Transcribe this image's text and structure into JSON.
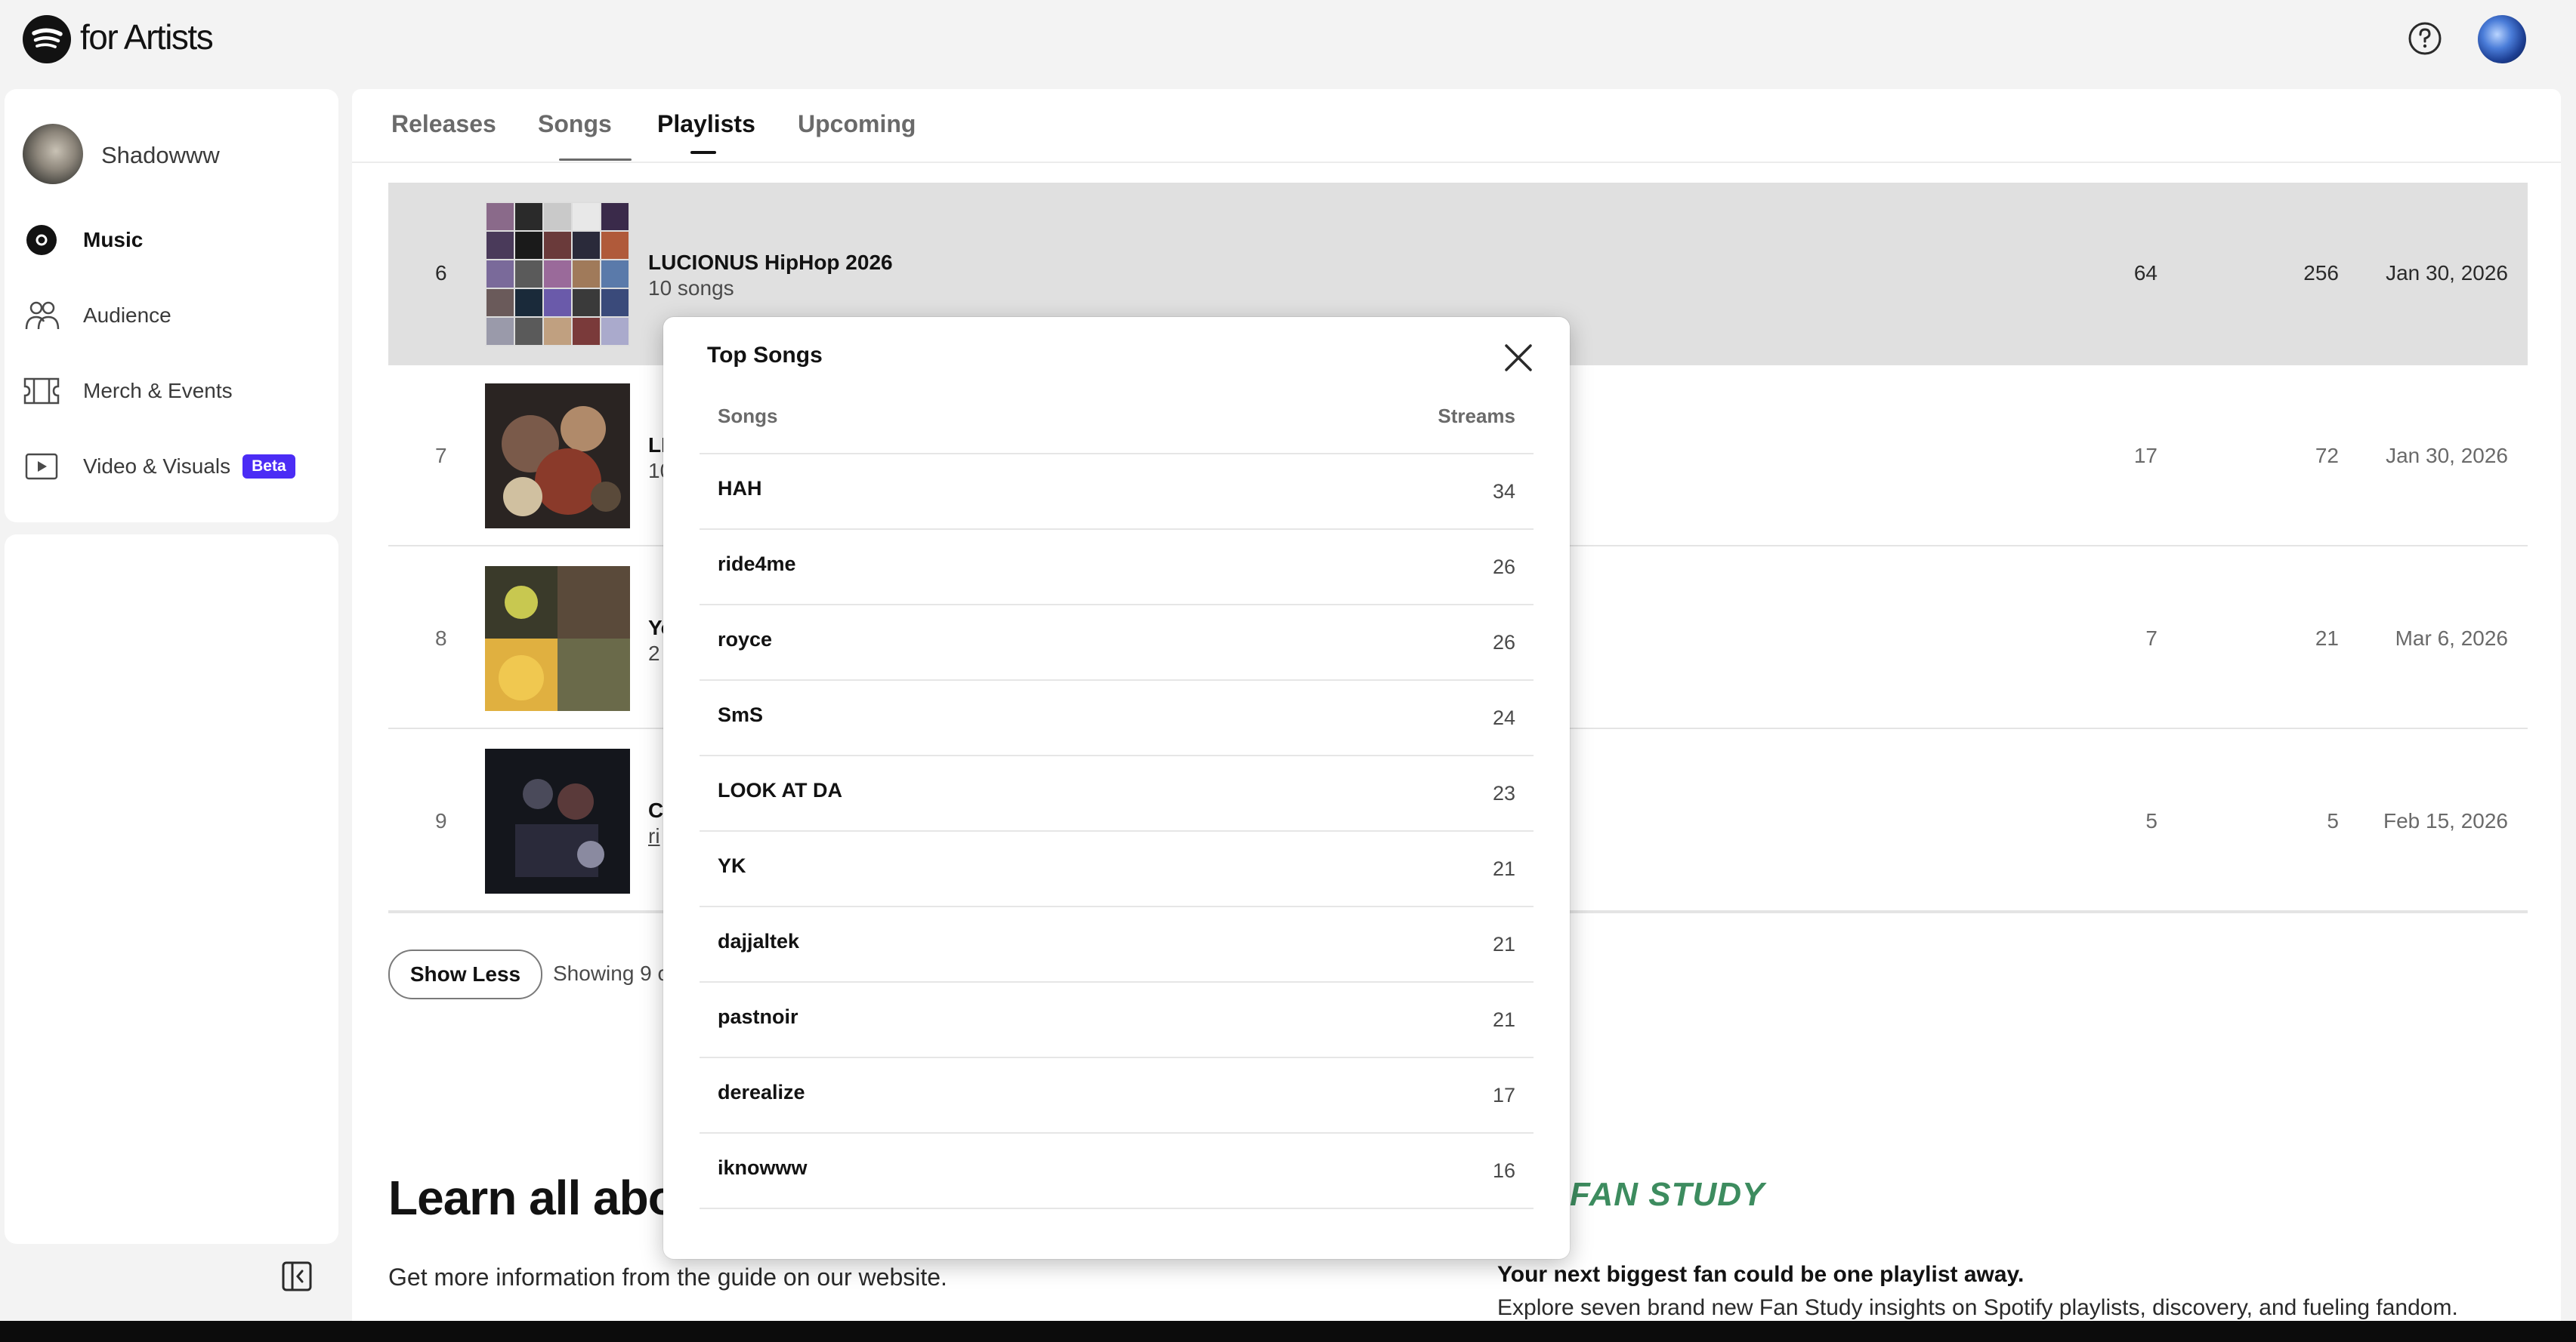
{
  "app": {
    "brand": "for Artists"
  },
  "sidebar": {
    "artist_name": "Shadowww",
    "items": [
      {
        "label": "Music",
        "icon": "music-disc-icon",
        "active": true
      },
      {
        "label": "Audience",
        "icon": "audience-icon"
      },
      {
        "label": "Merch & Events",
        "icon": "ticket-icon"
      },
      {
        "label": "Video & Visuals",
        "icon": "video-icon",
        "badge": "Beta"
      }
    ]
  },
  "tabs": [
    {
      "label": "Releases"
    },
    {
      "label": "Songs"
    },
    {
      "label": "Playlists",
      "active": true
    },
    {
      "label": "Upcoming"
    }
  ],
  "playlists": [
    {
      "rank": "6",
      "title": "LUCIONUS HipHop 2026",
      "subtitle": "10 songs",
      "listeners": "64",
      "streams": "256",
      "date": "Jan 30, 2026"
    },
    {
      "rank": "7",
      "title": "LI",
      "subtitle": "10",
      "listeners": "17",
      "streams": "72",
      "date": "Jan 30, 2026"
    },
    {
      "rank": "8",
      "title": "Yo",
      "subtitle": "2",
      "listeners": "7",
      "streams": "21",
      "date": "Mar 6, 2026"
    },
    {
      "rank": "9",
      "title": "Cl",
      "subtitle": "ri",
      "listeners": "5",
      "streams": "5",
      "date": "Feb 15, 2026"
    }
  ],
  "list_footer": {
    "show_less": "Show Less",
    "showing": "Showing 9 o"
  },
  "learn": {
    "heading": "Learn all abou",
    "sub": "Get more information from the guide on our website.",
    "fan_study": "FAN STUDY",
    "fan_heading": "Your next biggest fan could be one playlist away.",
    "fan_text": "Explore seven brand new Fan Study insights on Spotify playlists, discovery, and fueling fandom."
  },
  "popup": {
    "title": "Top Songs",
    "col_songs": "Songs",
    "col_streams": "Streams",
    "songs": [
      {
        "name": "HAH",
        "streams": "34"
      },
      {
        "name": "ride4me",
        "streams": "26"
      },
      {
        "name": "royce",
        "streams": "26"
      },
      {
        "name": "SmS",
        "streams": "24"
      },
      {
        "name": "LOOK AT DA",
        "streams": "23"
      },
      {
        "name": "YK",
        "streams": "21"
      },
      {
        "name": "dajjaltek",
        "streams": "21"
      },
      {
        "name": "pastnoir",
        "streams": "21"
      },
      {
        "name": "derealize",
        "streams": "17"
      },
      {
        "name": "iknowww",
        "streams": "16"
      }
    ]
  },
  "colors": {
    "beta_badge": "#4b2cf5",
    "fan_study": "#3d8c5f",
    "row_highlight": "#e0e0e0"
  }
}
